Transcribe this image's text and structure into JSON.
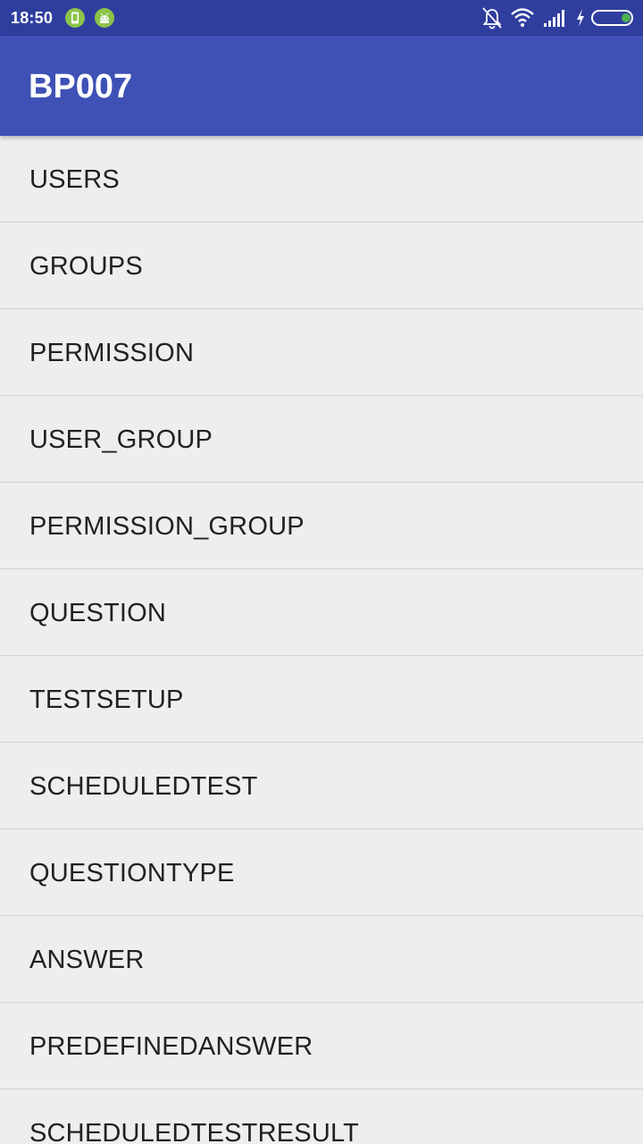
{
  "status_bar": {
    "time": "18:50",
    "notification_icons": [
      "phone-icon",
      "android-icon"
    ],
    "system_icons": [
      "bell-off-icon",
      "wifi-icon",
      "signal-icon",
      "charging-icon",
      "battery-icon"
    ],
    "notification_color": "#8bc34a",
    "battery_fill_color": "#4caf50"
  },
  "app_bar": {
    "title": "BP007",
    "color": "#3f51b5"
  },
  "list": {
    "items": [
      {
        "label": "USERS"
      },
      {
        "label": "GROUPS"
      },
      {
        "label": "PERMISSION"
      },
      {
        "label": "USER_GROUP"
      },
      {
        "label": "PERMISSION_GROUP"
      },
      {
        "label": "QUESTION"
      },
      {
        "label": "TESTSETUP"
      },
      {
        "label": "SCHEDULEDTEST"
      },
      {
        "label": "QUESTIONTYPE"
      },
      {
        "label": "ANSWER"
      },
      {
        "label": "PREDEFINEDANSWER"
      },
      {
        "label": "SCHEDULEDTESTRESULT"
      }
    ]
  }
}
